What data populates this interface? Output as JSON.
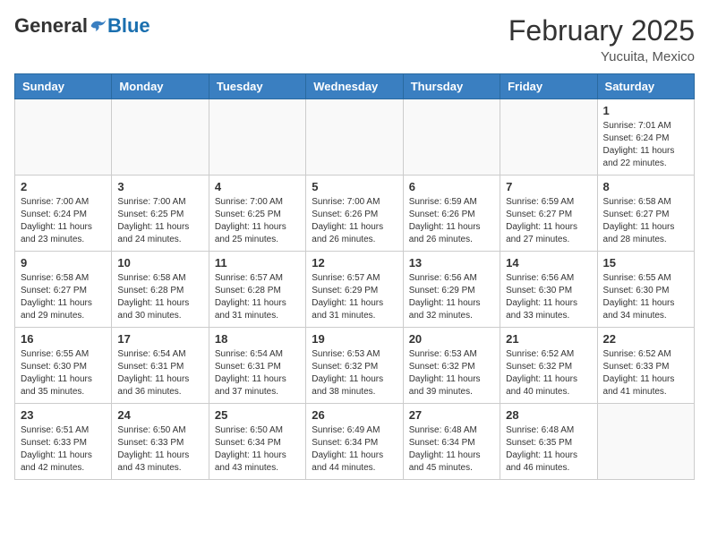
{
  "header": {
    "logo_general": "General",
    "logo_blue": "Blue",
    "month_title": "February 2025",
    "location": "Yucuita, Mexico"
  },
  "weekdays": [
    "Sunday",
    "Monday",
    "Tuesday",
    "Wednesday",
    "Thursday",
    "Friday",
    "Saturday"
  ],
  "weeks": [
    [
      {
        "day": "",
        "info": ""
      },
      {
        "day": "",
        "info": ""
      },
      {
        "day": "",
        "info": ""
      },
      {
        "day": "",
        "info": ""
      },
      {
        "day": "",
        "info": ""
      },
      {
        "day": "",
        "info": ""
      },
      {
        "day": "1",
        "info": "Sunrise: 7:01 AM\nSunset: 6:24 PM\nDaylight: 11 hours and 22 minutes."
      }
    ],
    [
      {
        "day": "2",
        "info": "Sunrise: 7:00 AM\nSunset: 6:24 PM\nDaylight: 11 hours and 23 minutes."
      },
      {
        "day": "3",
        "info": "Sunrise: 7:00 AM\nSunset: 6:25 PM\nDaylight: 11 hours and 24 minutes."
      },
      {
        "day": "4",
        "info": "Sunrise: 7:00 AM\nSunset: 6:25 PM\nDaylight: 11 hours and 25 minutes."
      },
      {
        "day": "5",
        "info": "Sunrise: 7:00 AM\nSunset: 6:26 PM\nDaylight: 11 hours and 26 minutes."
      },
      {
        "day": "6",
        "info": "Sunrise: 6:59 AM\nSunset: 6:26 PM\nDaylight: 11 hours and 26 minutes."
      },
      {
        "day": "7",
        "info": "Sunrise: 6:59 AM\nSunset: 6:27 PM\nDaylight: 11 hours and 27 minutes."
      },
      {
        "day": "8",
        "info": "Sunrise: 6:58 AM\nSunset: 6:27 PM\nDaylight: 11 hours and 28 minutes."
      }
    ],
    [
      {
        "day": "9",
        "info": "Sunrise: 6:58 AM\nSunset: 6:27 PM\nDaylight: 11 hours and 29 minutes."
      },
      {
        "day": "10",
        "info": "Sunrise: 6:58 AM\nSunset: 6:28 PM\nDaylight: 11 hours and 30 minutes."
      },
      {
        "day": "11",
        "info": "Sunrise: 6:57 AM\nSunset: 6:28 PM\nDaylight: 11 hours and 31 minutes."
      },
      {
        "day": "12",
        "info": "Sunrise: 6:57 AM\nSunset: 6:29 PM\nDaylight: 11 hours and 31 minutes."
      },
      {
        "day": "13",
        "info": "Sunrise: 6:56 AM\nSunset: 6:29 PM\nDaylight: 11 hours and 32 minutes."
      },
      {
        "day": "14",
        "info": "Sunrise: 6:56 AM\nSunset: 6:30 PM\nDaylight: 11 hours and 33 minutes."
      },
      {
        "day": "15",
        "info": "Sunrise: 6:55 AM\nSunset: 6:30 PM\nDaylight: 11 hours and 34 minutes."
      }
    ],
    [
      {
        "day": "16",
        "info": "Sunrise: 6:55 AM\nSunset: 6:30 PM\nDaylight: 11 hours and 35 minutes."
      },
      {
        "day": "17",
        "info": "Sunrise: 6:54 AM\nSunset: 6:31 PM\nDaylight: 11 hours and 36 minutes."
      },
      {
        "day": "18",
        "info": "Sunrise: 6:54 AM\nSunset: 6:31 PM\nDaylight: 11 hours and 37 minutes."
      },
      {
        "day": "19",
        "info": "Sunrise: 6:53 AM\nSunset: 6:32 PM\nDaylight: 11 hours and 38 minutes."
      },
      {
        "day": "20",
        "info": "Sunrise: 6:53 AM\nSunset: 6:32 PM\nDaylight: 11 hours and 39 minutes."
      },
      {
        "day": "21",
        "info": "Sunrise: 6:52 AM\nSunset: 6:32 PM\nDaylight: 11 hours and 40 minutes."
      },
      {
        "day": "22",
        "info": "Sunrise: 6:52 AM\nSunset: 6:33 PM\nDaylight: 11 hours and 41 minutes."
      }
    ],
    [
      {
        "day": "23",
        "info": "Sunrise: 6:51 AM\nSunset: 6:33 PM\nDaylight: 11 hours and 42 minutes."
      },
      {
        "day": "24",
        "info": "Sunrise: 6:50 AM\nSunset: 6:33 PM\nDaylight: 11 hours and 43 minutes."
      },
      {
        "day": "25",
        "info": "Sunrise: 6:50 AM\nSunset: 6:34 PM\nDaylight: 11 hours and 43 minutes."
      },
      {
        "day": "26",
        "info": "Sunrise: 6:49 AM\nSunset: 6:34 PM\nDaylight: 11 hours and 44 minutes."
      },
      {
        "day": "27",
        "info": "Sunrise: 6:48 AM\nSunset: 6:34 PM\nDaylight: 11 hours and 45 minutes."
      },
      {
        "day": "28",
        "info": "Sunrise: 6:48 AM\nSunset: 6:35 PM\nDaylight: 11 hours and 46 minutes."
      },
      {
        "day": "",
        "info": ""
      }
    ]
  ]
}
